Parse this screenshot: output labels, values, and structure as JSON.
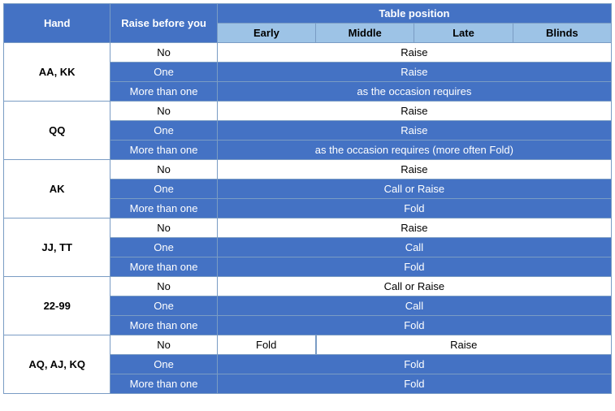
{
  "headers": {
    "hand": "Hand",
    "raise_before_you": "Raise before you",
    "table_position": "Table position",
    "early": "Early",
    "middle": "Middle",
    "late": "Late",
    "blinds": "Blinds"
  },
  "rows": [
    {
      "hand": "AA, KK",
      "scenarios": [
        {
          "raise": "No",
          "action": "Raise",
          "span": 4,
          "style": "white"
        },
        {
          "raise": "One",
          "action": "Raise",
          "span": 4,
          "style": "light"
        },
        {
          "raise": "More than one",
          "action": "as the occasion requires",
          "span": 4,
          "style": "blue"
        }
      ]
    },
    {
      "hand": "QQ",
      "scenarios": [
        {
          "raise": "No",
          "action": "Raise",
          "span": 4,
          "style": "white"
        },
        {
          "raise": "One",
          "action": "Raise",
          "span": 4,
          "style": "light"
        },
        {
          "raise": "More than one",
          "action": "as the occasion requires (more often Fold)",
          "span": 4,
          "style": "blue"
        }
      ]
    },
    {
      "hand": "AK",
      "scenarios": [
        {
          "raise": "No",
          "action": "Raise",
          "span": 4,
          "style": "white"
        },
        {
          "raise": "One",
          "action": "Call or Raise",
          "span": 4,
          "style": "light"
        },
        {
          "raise": "More than one",
          "action": "Fold",
          "span": 4,
          "style": "blue"
        }
      ]
    },
    {
      "hand": "JJ, TT",
      "scenarios": [
        {
          "raise": "No",
          "action": "Raise",
          "span": 4,
          "style": "white"
        },
        {
          "raise": "One",
          "action": "Call",
          "span": 4,
          "style": "light"
        },
        {
          "raise": "More than one",
          "action": "Fold",
          "span": 4,
          "style": "blue"
        }
      ]
    },
    {
      "hand": "22-99",
      "scenarios": [
        {
          "raise": "No",
          "action": "Call or Raise",
          "span": 4,
          "style": "white"
        },
        {
          "raise": "One",
          "action": "Call",
          "span": 4,
          "style": "light"
        },
        {
          "raise": "More than one",
          "action": "Fold",
          "span": 4,
          "style": "blue"
        }
      ]
    },
    {
      "hand": "AQ, AJ, KQ",
      "scenarios": [
        {
          "raise": "No",
          "early": "Fold",
          "rest": "Raise",
          "split": true,
          "style": "white"
        },
        {
          "raise": "One",
          "action": "Fold",
          "span": 4,
          "style": "light"
        },
        {
          "raise": "More than one",
          "action": "Fold",
          "span": 4,
          "style": "blue"
        }
      ]
    }
  ]
}
